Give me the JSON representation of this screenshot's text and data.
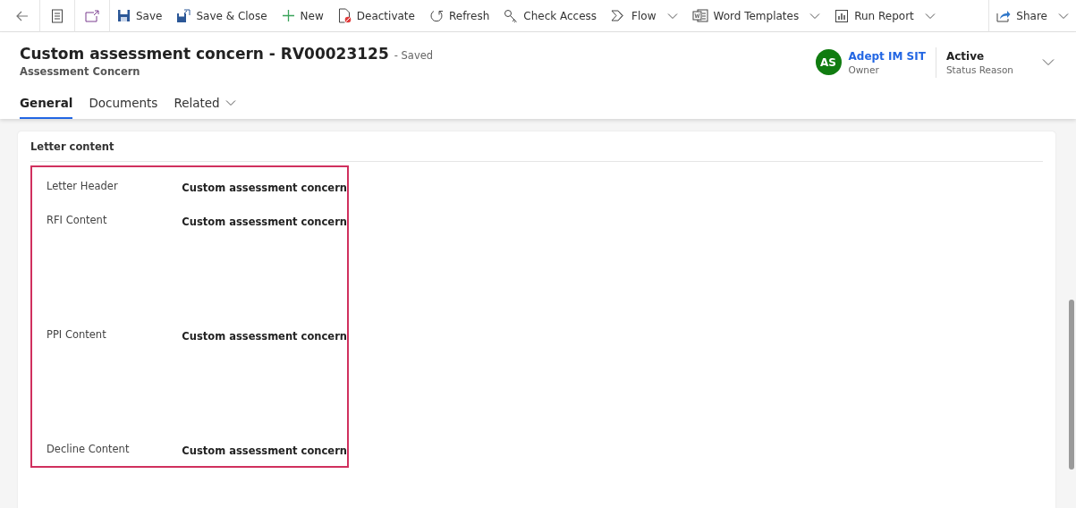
{
  "toolbar": {
    "items": [
      {
        "kind": "save",
        "label": "Save",
        "dropdown": false
      },
      {
        "kind": "save-close",
        "label": "Save & Close",
        "dropdown": false
      },
      {
        "kind": "new",
        "label": "New",
        "dropdown": false
      },
      {
        "kind": "deactivate",
        "label": "Deactivate",
        "dropdown": false
      },
      {
        "kind": "refresh",
        "label": "Refresh",
        "dropdown": false
      },
      {
        "kind": "key",
        "label": "Check Access",
        "dropdown": false
      },
      {
        "kind": "flow",
        "label": "Flow",
        "dropdown": true
      },
      {
        "kind": "word",
        "label": "Word Templates",
        "dropdown": true
      },
      {
        "kind": "report",
        "label": "Run Report",
        "dropdown": true
      }
    ],
    "share": {
      "label": "Share",
      "dropdown": true
    }
  },
  "header": {
    "title": "Custom assessment concern - RV00023125",
    "save_status": "- Saved",
    "entity": "Assessment Concern",
    "owner": {
      "initials": "AS",
      "name": "Adept IM SIT",
      "label": "Owner"
    },
    "status": {
      "value": "Active",
      "label": "Status Reason"
    }
  },
  "tabs": [
    {
      "label": "General",
      "selected": true,
      "dropdown": false
    },
    {
      "label": "Documents",
      "selected": false,
      "dropdown": false
    },
    {
      "label": "Related",
      "selected": false,
      "dropdown": true
    }
  ],
  "section": {
    "title": "Letter content",
    "fields": [
      {
        "kind": "single",
        "label": "Letter Header",
        "value": "Custom assessment concern"
      },
      {
        "kind": "multiline",
        "label": "RFI Content",
        "value": "Custom assessment concern"
      },
      {
        "kind": "multiline",
        "label": "PPI Content",
        "value": "Custom assessment concern"
      },
      {
        "kind": "single",
        "label": "Decline Content",
        "value": "Custom assessment concern"
      }
    ]
  }
}
